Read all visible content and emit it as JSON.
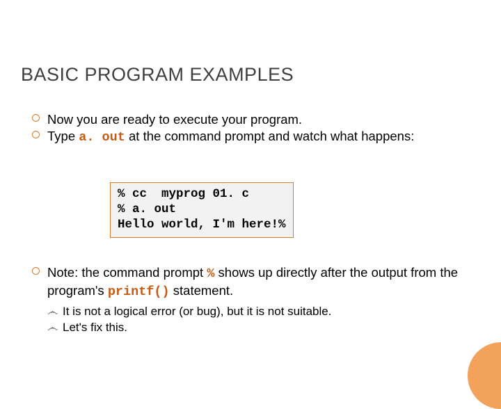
{
  "heading": "BASIC PROGRAM EXAMPLES",
  "bullets": {
    "b1": "Now you are ready to execute your program.",
    "b2_pre": "Type ",
    "b2_code": "a. out",
    "b2_post": " at the command prompt and watch what happens:"
  },
  "code": {
    "line1": "% cc  myprog 01. c",
    "line2": "% a. out",
    "line3": "Hello world, I'm here!%"
  },
  "note": {
    "pre": "Note:  the command prompt ",
    "pct": "%",
    "mid": " shows up directly after the output from the program's ",
    "printf": "printf()",
    "post": " statement."
  },
  "subs": {
    "s1": "It is not a logical error (or bug), but it is not suitable.",
    "s2": "Let's fix this."
  },
  "markers": {
    "sub": "෴"
  },
  "chart_data": null
}
